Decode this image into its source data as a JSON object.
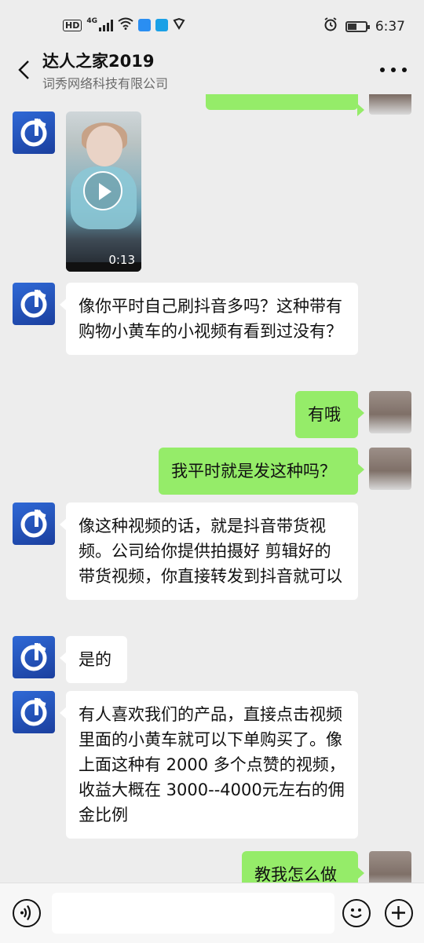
{
  "status_bar": {
    "hd": "HD",
    "network": "4G",
    "time": "6:37"
  },
  "header": {
    "title": "达人之家2019",
    "subtitle": "词秀网络科技有限公司"
  },
  "messages": [
    {
      "side": "in",
      "type": "video",
      "duration": "0:13"
    },
    {
      "side": "in",
      "text": "像你平时自己刷抖音多吗？这种带有购物小黄车的小视频有看到过没有？"
    },
    {
      "side": "out",
      "text": "有哦"
    },
    {
      "side": "out",
      "text": "我平时就是发这种吗？"
    },
    {
      "side": "in",
      "text": "像这种视频的话，就是抖音带货视频。公司给你提供拍摄好 剪辑好的带货视频，你直接转发到抖音就可以"
    },
    {
      "side": "in",
      "text": "是的"
    },
    {
      "side": "in",
      "text": "有人喜欢我们的产品，直接点击视频里面的小黄车就可以下单购买了。像上面这种有 2000 多个点赞的视频，收益大概在 3000--4000元左右的佣金比例"
    },
    {
      "side": "out",
      "text": "教我怎么做"
    }
  ],
  "input": {
    "placeholder": ""
  },
  "colors": {
    "outgoing": "#95ec69",
    "incoming": "#ffffff",
    "background": "#ededed"
  }
}
